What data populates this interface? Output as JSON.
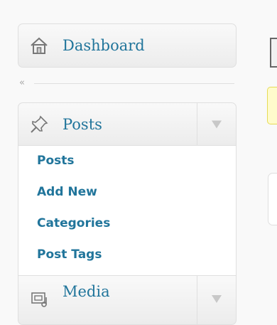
{
  "menu": {
    "dashboard": {
      "label": "Dashboard",
      "icon": "home-icon"
    },
    "collapse": {
      "label": "«"
    },
    "posts": {
      "label": "Posts",
      "icon": "pushpin-icon",
      "expanded": true,
      "submenu": [
        "Posts",
        "Add New",
        "Categories",
        "Post Tags"
      ]
    },
    "media": {
      "label": "Media",
      "icon": "media-icon"
    }
  },
  "colors": {
    "link": "#21759b",
    "border": "#dfdfdf",
    "notice_border": "#e6db55",
    "notice_bg": "#fffbcc"
  }
}
